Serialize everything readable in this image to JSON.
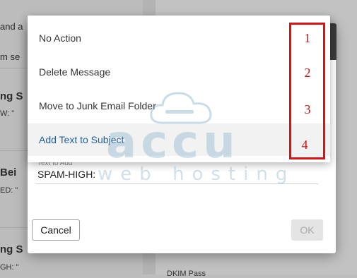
{
  "background": {
    "left_texts": [
      "and a",
      "m se",
      "ng S",
      "W: \"",
      "Bei",
      "ED: \"",
      "ng S",
      "GH: \""
    ],
    "right_texts": [
      "DKIM Pass"
    ]
  },
  "dialog": {
    "field_label": "Text to Add",
    "field_value": "SPAM-HIGH:",
    "cancel_label": "Cancel",
    "ok_label": "OK"
  },
  "dropdown": {
    "options": [
      {
        "label": "No Action",
        "number": "1"
      },
      {
        "label": "Delete Message",
        "number": "2"
      },
      {
        "label": "Move to Junk Email Folder",
        "number": "3"
      },
      {
        "label": "Add Text to Subject",
        "number": "4"
      }
    ],
    "selected_index": 3
  },
  "watermark": {
    "line1": "accu",
    "line2": "web hosting"
  },
  "colors": {
    "highlight": "#dd1111",
    "selected_text": "#1f5e9b"
  }
}
